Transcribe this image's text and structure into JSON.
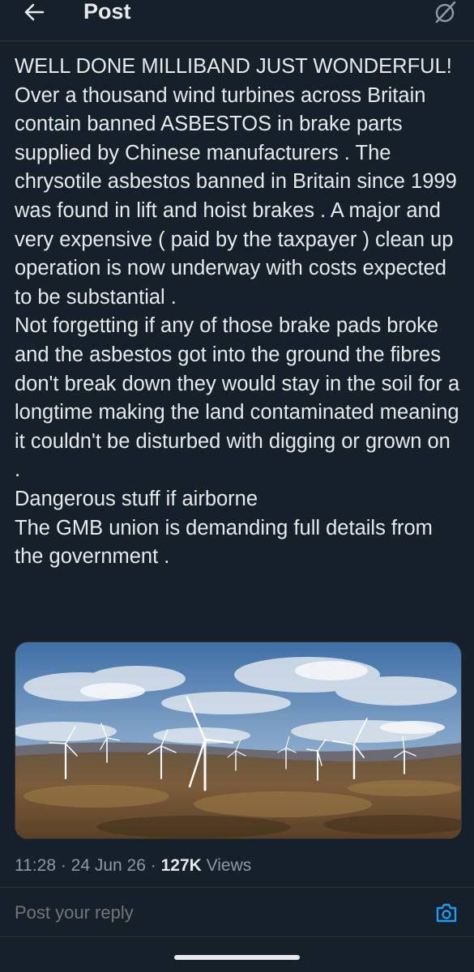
{
  "header": {
    "title": "Post",
    "back_icon": "arrow-left-icon",
    "grok_icon": "grok-icon"
  },
  "post": {
    "paragraphs": [
      "WELL DONE MILLIBAND JUST WONDERFUL!",
      "Over a thousand wind turbines across Britain contain banned ASBESTOS in brake parts supplied by Chinese manufacturers . The chrysotile asbestos banned in Britain since 1999 was found in lift and hoist brakes . A major and very expensive ( paid by the taxpayer ) clean up operation is now underway with costs expected to be substantial .",
      "Not forgetting if any of those brake pads broke and the asbestos got into the ground the fibres don't break down they would stay in the soil for a longtime making the land contaminated meaning it couldn't be disturbed with digging or grown on .",
      "Dangerous stuff if airborne",
      "The GMB union is demanding full details from the government ."
    ],
    "meta": {
      "time": "11:28",
      "separator": " · ",
      "date": "24 Jun 26",
      "views_count": "127K",
      "views_label": " Views"
    }
  },
  "reply": {
    "placeholder": "Post your reply",
    "camera_icon": "camera-icon"
  },
  "colors": {
    "background": "#15202b",
    "text": "#e7e9ea",
    "muted": "#8b98a5",
    "accent": "#1d9bf0"
  }
}
